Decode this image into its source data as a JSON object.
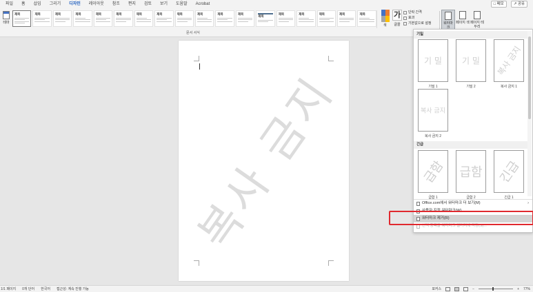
{
  "menubar": {
    "tabs": [
      "파일",
      "홈",
      "삽입",
      "그리기",
      "디자인",
      "레이아웃",
      "참조",
      "편지",
      "검토",
      "보기",
      "도움말",
      "Acrobat"
    ],
    "active_tab": "디자인",
    "memo_label": "메모",
    "share_label": "공유"
  },
  "ribbon": {
    "theme_label": "테마",
    "gallery_label": "문서 서식",
    "styles": [
      "제목",
      "제목",
      "제목",
      "제목",
      "제목",
      "제목",
      "제목",
      "제목",
      "제목",
      "제목",
      "제목",
      "제목",
      "제목",
      "제목",
      "제목",
      "제목",
      "제목",
      "제목"
    ],
    "colors_label": "색",
    "fonts_label": "글꼴",
    "fonts_glyph": "가",
    "para_spacing": "단락 간격",
    "effects": "효과",
    "set_default": "기본값으로 설정",
    "watermark_label": "워터마크",
    "page_color_label": "페이지 색",
    "page_border_label": "페이지 테두리"
  },
  "document": {
    "watermark_text": "복사 금지"
  },
  "watermark_panel": {
    "section_confidential": "기밀",
    "section_urgent": "긴급",
    "items_confidential": [
      {
        "text": "기 밀",
        "label": "기밀 1",
        "style": "horizontal"
      },
      {
        "text": "기 밀",
        "label": "기밀 2",
        "style": "horizontal"
      },
      {
        "text": "복사 금지",
        "label": "복사 금지 1",
        "style": "diagonal"
      },
      {
        "text": "복사 금지",
        "label": "복사 금지 2",
        "style": "horizontal"
      }
    ],
    "items_urgent": [
      {
        "text": "급함",
        "label": "급함 1",
        "style": "diagonal"
      },
      {
        "text": "급함",
        "label": "급함 2",
        "style": "horizontal"
      },
      {
        "text": "긴급",
        "label": "긴급 1",
        "style": "diagonal"
      }
    ],
    "menu": {
      "more_online": "Office.com에서 워터마크 더 보기(M)",
      "custom": "사용자 지정 워터마크(W)...",
      "remove": "워터마크 제거(R)",
      "save_selection": "선택 항목을 워터마크 갤러리에 저장(S)..."
    }
  },
  "status": {
    "page": "1/1 페이지",
    "words": "0개 단어",
    "lang": "한국어",
    "accessibility": "접근성: 계속 진행 가능",
    "focus": "포커스",
    "zoom": "77%"
  },
  "colors": {
    "accent": "#185abd",
    "highlight_box": "#e0282e"
  }
}
